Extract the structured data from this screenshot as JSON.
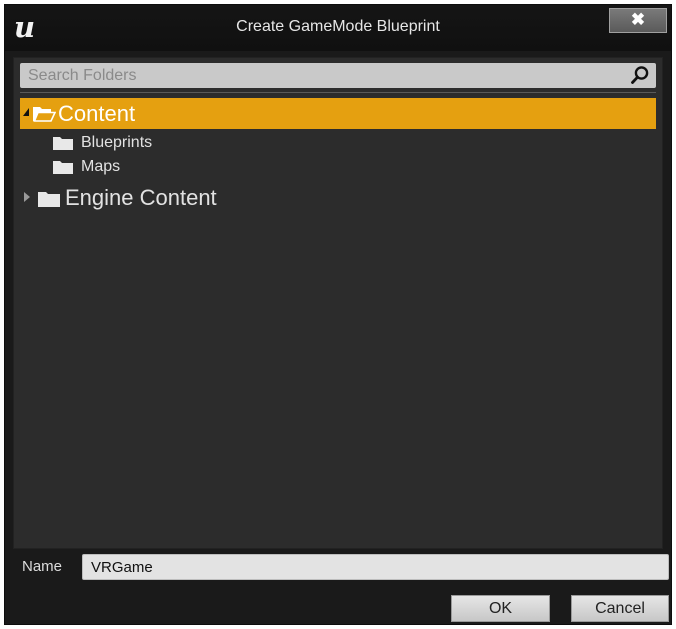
{
  "window": {
    "title": "Create GameMode Blueprint",
    "logo": "u",
    "close_glyph": "✖",
    "close_icon": "close-icon"
  },
  "search": {
    "placeholder": "Search Folders",
    "value": "",
    "icon": "search-icon"
  },
  "tree": {
    "items": [
      {
        "label": "Content",
        "icon": "folder-open-icon",
        "expanded": true,
        "selected": true,
        "level": 0
      },
      {
        "label": "Blueprints",
        "icon": "folder-icon",
        "level": 1
      },
      {
        "label": "Maps",
        "icon": "folder-icon",
        "level": 1
      },
      {
        "label": "Engine Content",
        "icon": "folder-icon",
        "expanded": false,
        "level": 0
      }
    ]
  },
  "name_field": {
    "label": "Name",
    "value": "VRGame"
  },
  "buttons": {
    "ok": "OK",
    "cancel": "Cancel"
  },
  "colors": {
    "selection": "#e5a010",
    "panel": "#2c2c2c",
    "frame": "#1a1a1a"
  }
}
